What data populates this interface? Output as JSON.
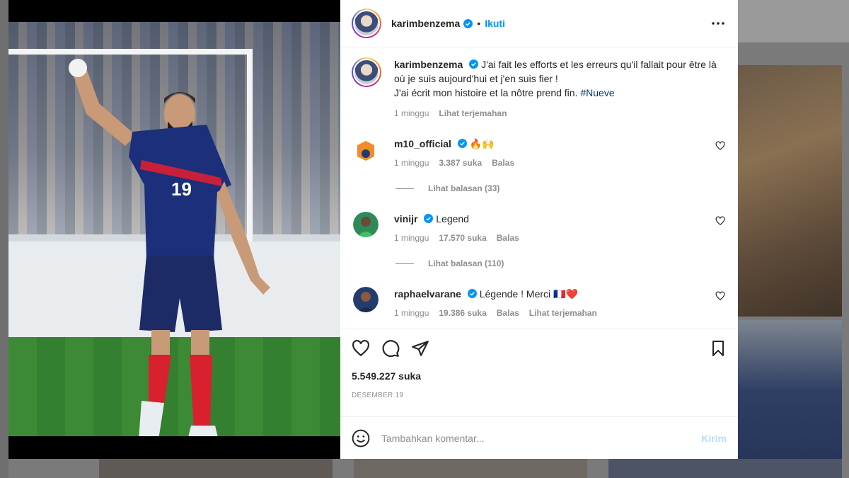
{
  "post": {
    "username": "karimbenzema",
    "follow_label": "Ikuti",
    "caption_line1": "J'ai fait les efforts et les erreurs qu'il fallait pour être là où je suis aujourd'hui et j'en suis fier !",
    "caption_line2": "J'ai écrit mon histoire et la nôtre prend fin.",
    "hashtag": "#Nueve",
    "caption_time": "1 minggu",
    "translate_label": "Lihat terjemahan",
    "likes": "5.549.227 suka",
    "date": "DESEMBER 19",
    "jersey_number": "19"
  },
  "comments": [
    {
      "username": "m10_official",
      "text": "🔥🙌",
      "time": "1 minggu",
      "likes": "3.387 suka",
      "reply_label": "Balas",
      "view_replies": "Lihat balasan (33)"
    },
    {
      "username": "vinijr",
      "text": "Legend",
      "time": "1 minggu",
      "likes": "17.570 suka",
      "reply_label": "Balas",
      "view_replies": "Lihat balasan (110)"
    },
    {
      "username": "raphaelvarane",
      "text": "Légende ! Merci 🇫🇷❤️",
      "time": "1 minggu",
      "likes": "19.386 suka",
      "reply_label": "Balas",
      "view_replies": "Lihat terjemahan"
    }
  ],
  "add_comment": {
    "placeholder": "Tambahkan komentar...",
    "post_label": "Kirim"
  },
  "colors": {
    "accent": "#0095f6",
    "verified": "#0095f6",
    "muted": "#8e8e8e",
    "post_disabled": "#b2dffc"
  },
  "icons": [
    "more-icon",
    "heart-icon",
    "comment-icon",
    "share-icon",
    "bookmark-icon",
    "emoji-icon",
    "verified-icon"
  ]
}
